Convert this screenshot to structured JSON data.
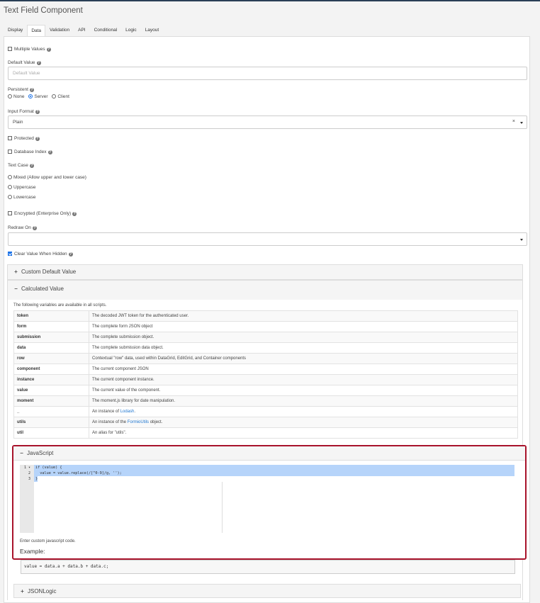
{
  "title": "Text Field Component",
  "tabs": [
    "Display",
    "Data",
    "Validation",
    "API",
    "Conditional",
    "Logic",
    "Layout"
  ],
  "active_tab": "Data",
  "multiple_values": {
    "label": "Multiple Values",
    "checked": false
  },
  "default_value": {
    "label": "Default Value",
    "placeholder": "Default Value"
  },
  "persistent": {
    "label": "Persistent",
    "options": [
      "None",
      "Server",
      "Client"
    ],
    "selected": "Server"
  },
  "input_format": {
    "label": "Input Format",
    "value": "Plain",
    "clear": "×"
  },
  "protected": {
    "label": "Protected",
    "checked": false
  },
  "database_index": {
    "label": "Database Index",
    "checked": false
  },
  "text_case": {
    "label": "Text Case",
    "options": [
      "Mixed (Allow upper and lower case)",
      "Uppercase",
      "Lowercase"
    ]
  },
  "encrypted": {
    "label": "Encrypted (Enterprise Only)",
    "checked": false
  },
  "redraw_on": {
    "label": "Redraw On",
    "value": ""
  },
  "clear_value": {
    "label": "Clear Value When Hidden",
    "checked": true
  },
  "custom_default": {
    "label": "Custom Default Value"
  },
  "calculated": {
    "label": "Calculated Value",
    "note": "The following variables are available in all scripts.",
    "vars": [
      {
        "k": "token",
        "v": "The decoded JWT token for the authenticated user."
      },
      {
        "k": "form",
        "v": "The complete form JSON object"
      },
      {
        "k": "submission",
        "v": "The complete submission object."
      },
      {
        "k": "data",
        "v": "The complete submission data object."
      },
      {
        "k": "row",
        "v": "Contextual \"row\" data, used within DataGrid, EditGrid, and Container components"
      },
      {
        "k": "component",
        "v": "The current component JSON"
      },
      {
        "k": "instance",
        "v": "The current component instance."
      },
      {
        "k": "value",
        "v": "The current value of the component."
      },
      {
        "k": "moment",
        "v": "The moment.js library for date manipulation."
      },
      {
        "k": "_",
        "v_pre": "An instance of ",
        "v_link": "Lodash",
        "v_post": "."
      },
      {
        "k": "utils",
        "v_pre": "An instance of the ",
        "v_link": "FormioUtils",
        "v_post": " object."
      },
      {
        "k": "util",
        "v": "An alias for \"utils\"."
      }
    ]
  },
  "javascript": {
    "label": "JavaScript",
    "gutter": [
      "1 ▾",
      "2",
      "3"
    ],
    "code": [
      "if (value) {",
      "  value = value.replace(/[^0-9]/g, '');",
      "}"
    ],
    "hint": "Enter custom javascript code.",
    "example_label": "Example:",
    "example_code": "value = data.a + data.b + data.c;"
  },
  "jsonlogic": {
    "label": "JSONLogic"
  }
}
